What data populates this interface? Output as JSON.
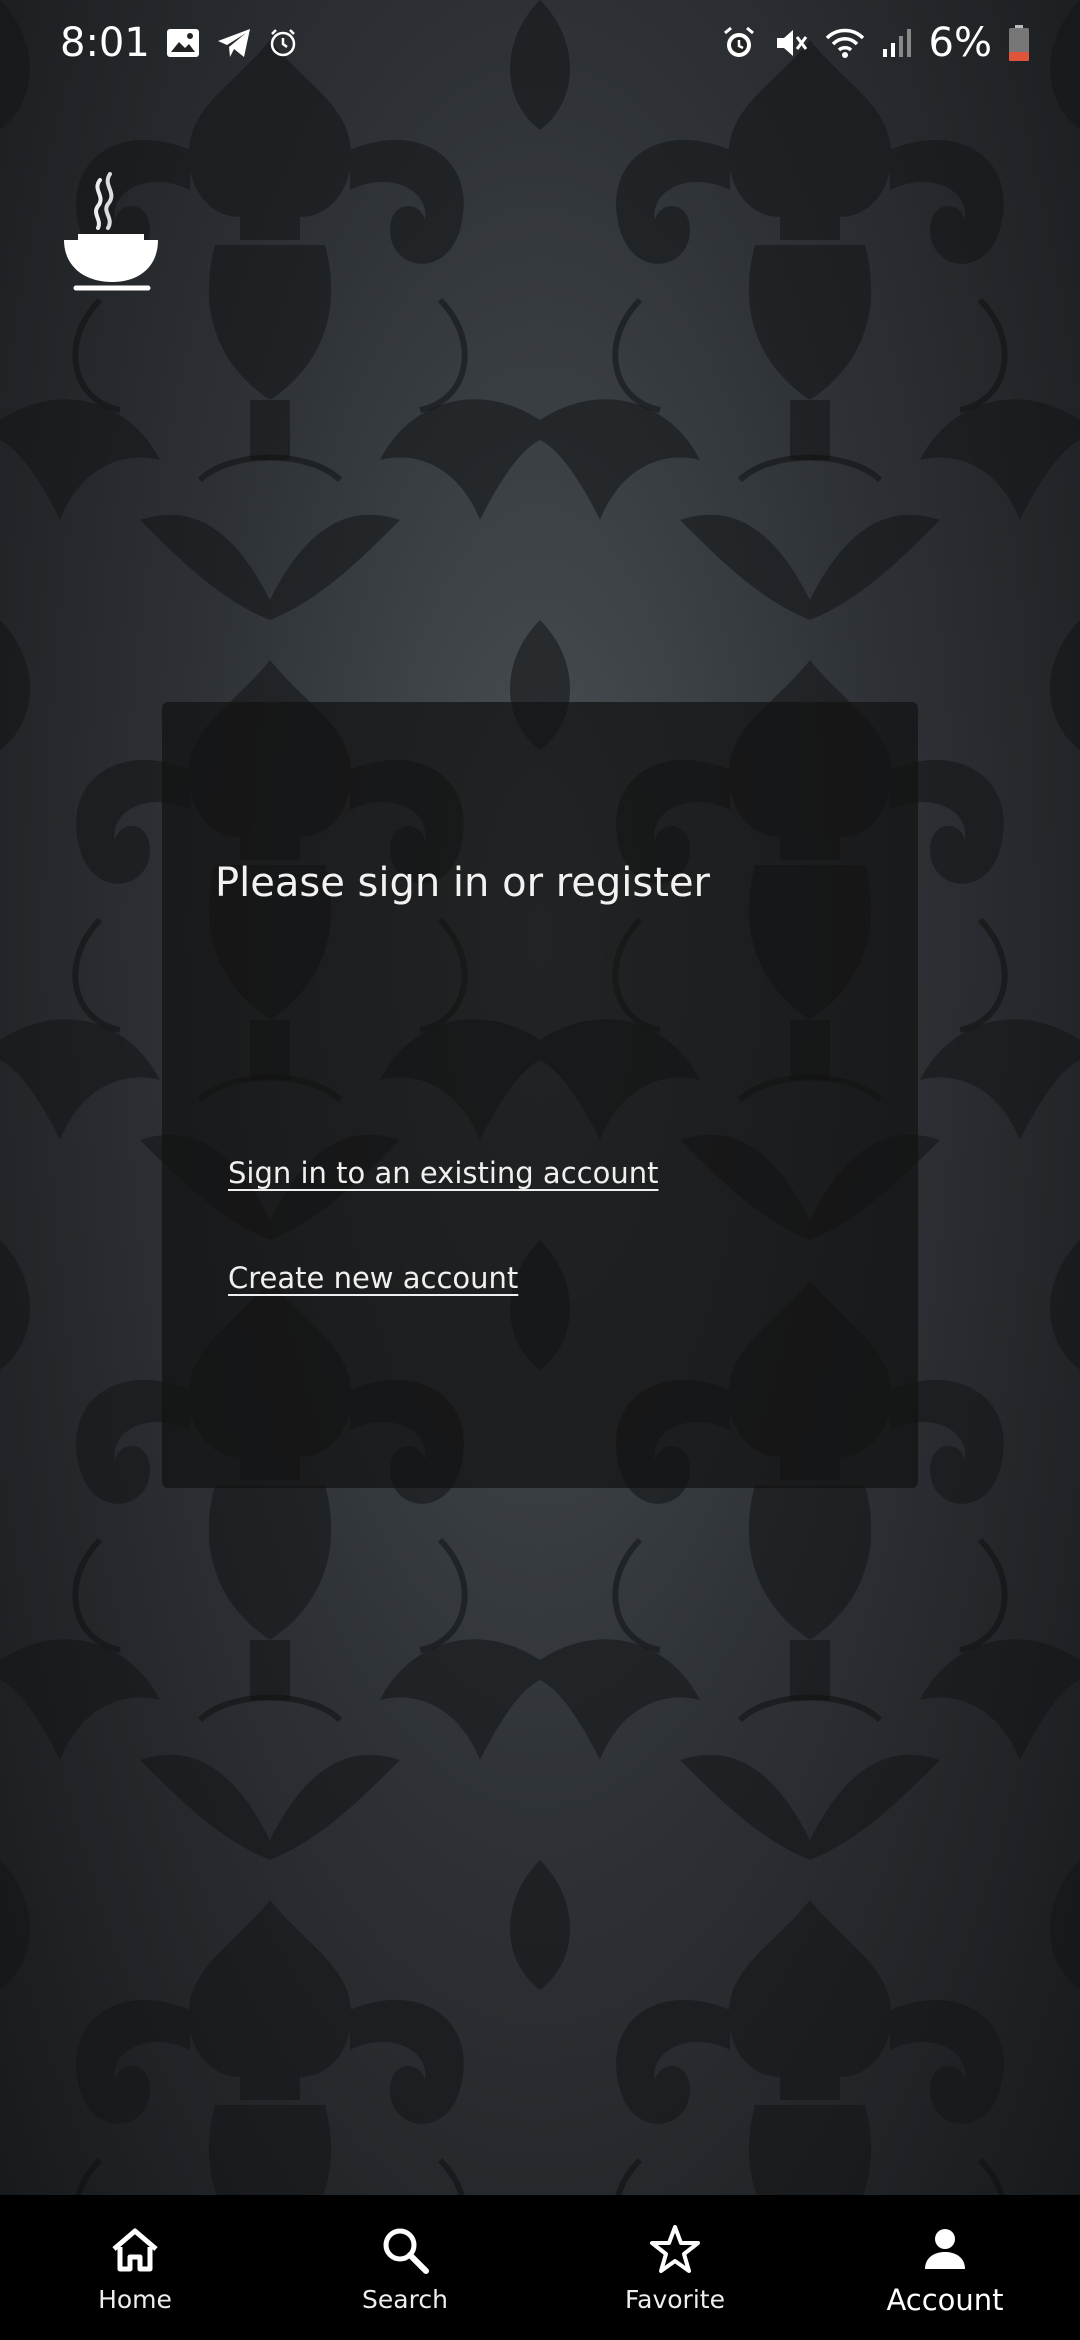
{
  "status_bar": {
    "time": "8:01",
    "battery_percent": "6%",
    "left_icons": [
      "image-icon",
      "telegram-icon",
      "alarm-clock-icon"
    ],
    "right_icons": [
      "alarm-icon",
      "mute-icon",
      "wifi-icon",
      "signal-icon",
      "battery-low-icon"
    ],
    "battery_color": "#e0553a"
  },
  "card": {
    "title": "Please sign in or register",
    "signin_link": "Sign in to an existing account",
    "create_link": "Create new account"
  },
  "bottom_nav": {
    "items": [
      {
        "label": "Home",
        "icon": "home-icon"
      },
      {
        "label": "Search",
        "icon": "search-icon"
      },
      {
        "label": "Favorite",
        "icon": "star-icon"
      },
      {
        "label": "Account",
        "icon": "person-icon",
        "active": true
      }
    ]
  }
}
